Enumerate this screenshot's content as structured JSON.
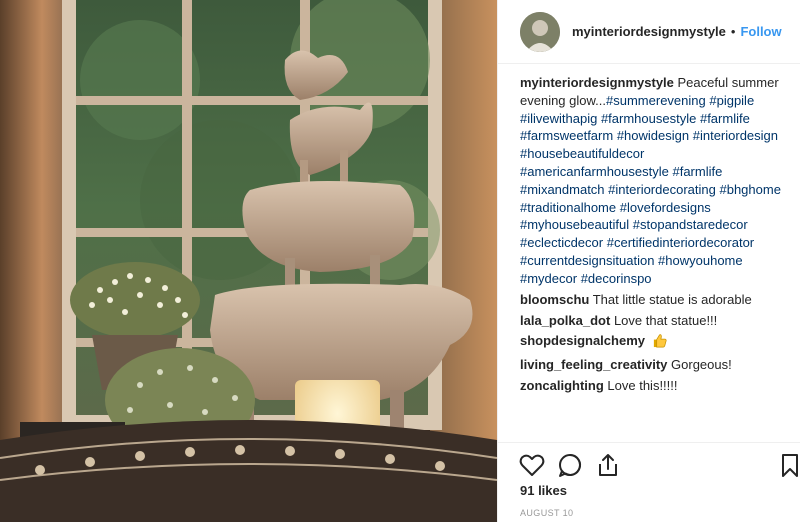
{
  "post": {
    "username": "myinteriordesignmystyle",
    "separator": "•",
    "follow_label": "Follow",
    "caption": {
      "username": "myinteriordesignmystyle",
      "text": " Peaceful summer evening glow...",
      "hashtags": [
        "#summerevening",
        "#pigpile",
        "#ilivewithapig",
        "#farmhousestyle",
        "#farmlife",
        "#farmsweetfarm",
        "#howidesign",
        "#interiordesign",
        "#housebeautifuldecor",
        "#americanfarmhousestyle",
        "#farmlife",
        "#mixandmatch",
        "#interiordecorating",
        "#bhghome",
        "#traditionalhome",
        "#lovefordesigns",
        "#myhousebeautiful",
        "#stopandstaredecor",
        "#eclecticdecor",
        "#certifiedinteriordecorator",
        "#currentdesignsituation",
        "#howyouhome",
        "#mydecor",
        "#decorinspo"
      ]
    },
    "comments": [
      {
        "username": "bloomschu",
        "text": "That little statue is adorable"
      },
      {
        "username": "lala_polka_dot",
        "text": "Love that statue!!!"
      },
      {
        "username": "shopdesignalchemy",
        "text": "",
        "emoji": "thumbs-up"
      },
      {
        "username": "living_feeling_creativity",
        "text": "Gorgeous!"
      },
      {
        "username": "zoncalighting",
        "text": "Love this!!!!!"
      }
    ],
    "likes": "91 likes",
    "date": "AUGUST 10",
    "icons": {
      "like": "heart-icon",
      "comment": "comment-icon",
      "share": "share-icon",
      "save": "bookmark-icon"
    }
  }
}
